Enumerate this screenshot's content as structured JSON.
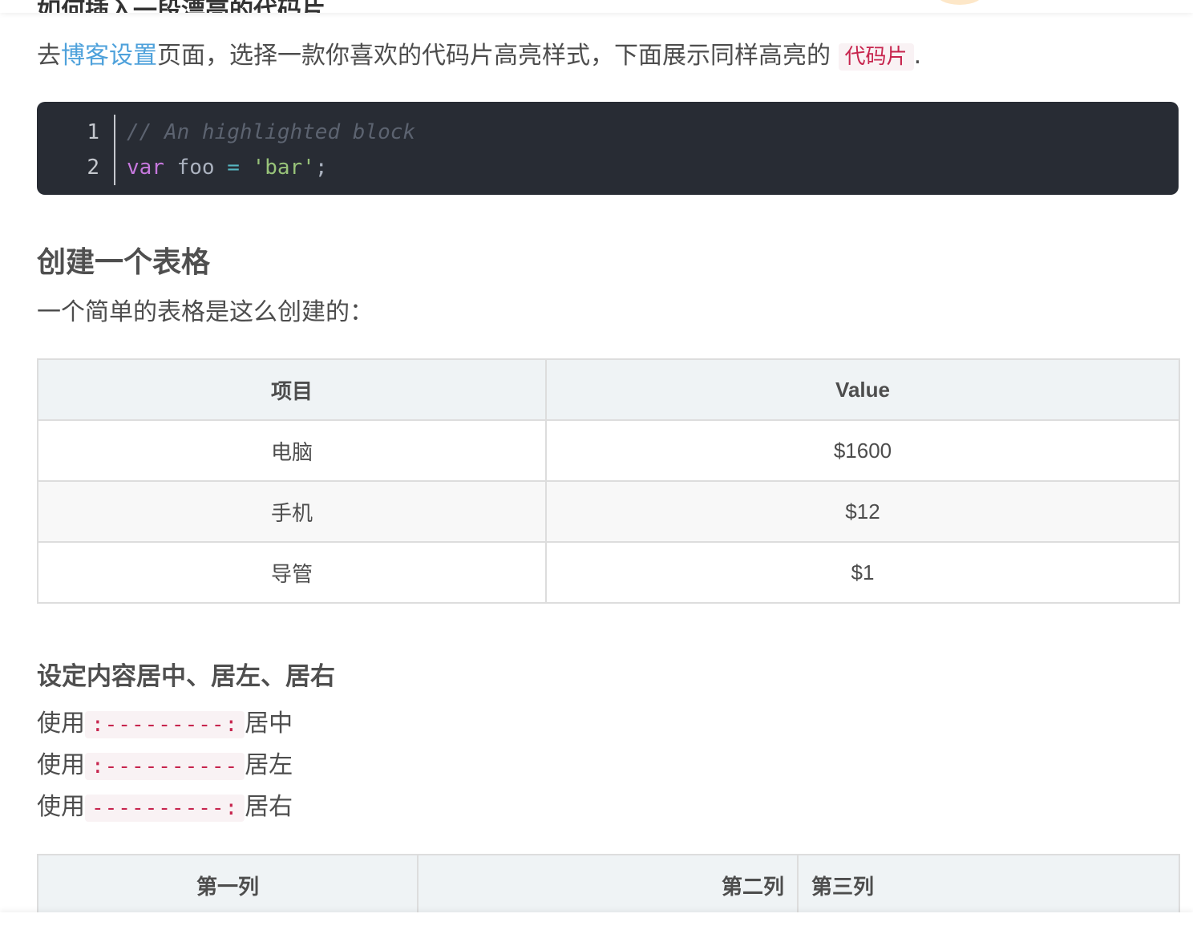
{
  "header": {
    "cut_heading": "如何插入一段漂亮的代码片"
  },
  "intro": {
    "prefix": "去",
    "link": "博客设置",
    "middle": "页面，选择一款你喜欢的代码片高亮样式，下面展示同样高亮的 ",
    "code": "代码片",
    "suffix": "."
  },
  "code_block": {
    "line_numbers": [
      "1",
      "2"
    ],
    "line1_comment": "// An highlighted block",
    "line2": {
      "kw": "var",
      "ident": " foo ",
      "op": "=",
      "space": " ",
      "str": "'bar'",
      "end": ";"
    },
    "colors": {
      "background": "#282c34",
      "keyword": "#c678dd",
      "string": "#98c379",
      "comment": "#5c6370"
    }
  },
  "section_table": {
    "heading": "创建一个表格",
    "desc": "一个简单的表格是这么创建的：",
    "headers": [
      "项目",
      "Value"
    ],
    "rows": [
      [
        "电脑",
        "$1600"
      ],
      [
        "手机",
        "$12"
      ],
      [
        "导管",
        "$1"
      ]
    ]
  },
  "section_align": {
    "heading": "设定内容居中、居左、居右",
    "lines": [
      {
        "prefix": "使用",
        "code": ":---------:",
        "suffix": "居中"
      },
      {
        "prefix": "使用",
        "code": ":----------",
        "suffix": "居左"
      },
      {
        "prefix": "使用",
        "code": "----------:",
        "suffix": "居右"
      }
    ],
    "headers": [
      "第一列",
      "第二列",
      "第三列"
    ]
  }
}
